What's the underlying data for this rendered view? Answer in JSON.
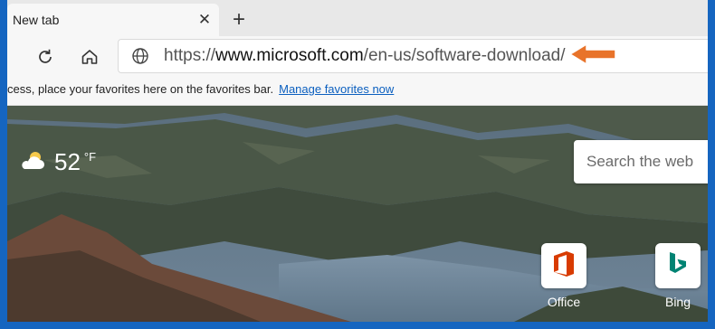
{
  "tabs": {
    "active_title": "New tab",
    "close_icon": "close-icon",
    "new_tab_icon": "plus-icon"
  },
  "toolbar": {
    "refresh_icon": "refresh-icon",
    "home_icon": "home-icon",
    "site_icon": "globe-icon"
  },
  "address": {
    "scheme": "https://",
    "host": "www.microsoft.com",
    "path": "/en-us/software-download/"
  },
  "annotation": {
    "icon": "arrow-left-icon",
    "color": "#e8732a"
  },
  "favorites_bar": {
    "message": "cess, place your favorites here on the favorites bar.",
    "link": "Manage favorites now"
  },
  "weather": {
    "icon": "partly-cloudy-icon",
    "temperature": "52",
    "unit": "°F"
  },
  "search": {
    "placeholder": "Search the web"
  },
  "quick_links": [
    {
      "label": "Office",
      "icon": "office-icon",
      "color": "#d83b01"
    },
    {
      "label": "Bing",
      "icon": "bing-icon",
      "color": "#008373"
    }
  ],
  "colors": {
    "frame": "#1565c0",
    "link": "#0b5fbf"
  }
}
